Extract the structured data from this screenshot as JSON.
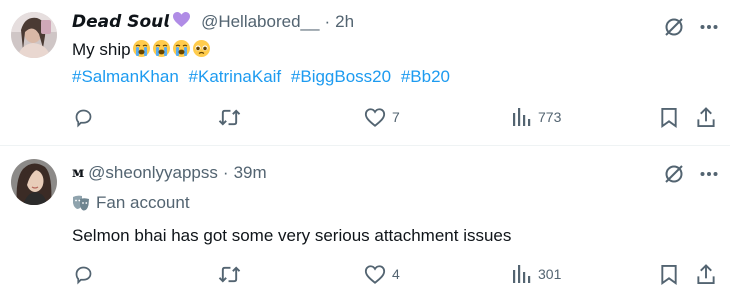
{
  "tweets": [
    {
      "display_name": "𝘿𝙚𝙖𝙙 𝙎𝙤𝙪𝙡",
      "badge_emoji": "purple-heart",
      "handle": "@Hellabored__",
      "separator": "·",
      "time": "2h",
      "text": "My ship",
      "emojis": [
        "loudly-crying",
        "loudly-crying",
        "loudly-crying",
        "pleading-face"
      ],
      "hashtags": [
        "#SalmanKhan",
        "#KatrinaKaif",
        "#BiggBoss20",
        "#Bb20"
      ],
      "actions": {
        "reply_count": "",
        "retweet_count": "",
        "like_count": "7",
        "views_count": "773"
      }
    },
    {
      "display_name": "ᴍ",
      "handle": "@sheonlyyappss",
      "separator": "·",
      "time": "39m",
      "label": "Fan account",
      "text": "Selmon bhai has got some very serious attachment issues",
      "actions": {
        "reply_count": "",
        "retweet_count": "",
        "like_count": "4",
        "views_count": "301"
      }
    }
  ],
  "colors": {
    "text": "#0f1419",
    "secondary": "#536471",
    "link": "#1d9bf0",
    "divider": "#eff3f4"
  }
}
